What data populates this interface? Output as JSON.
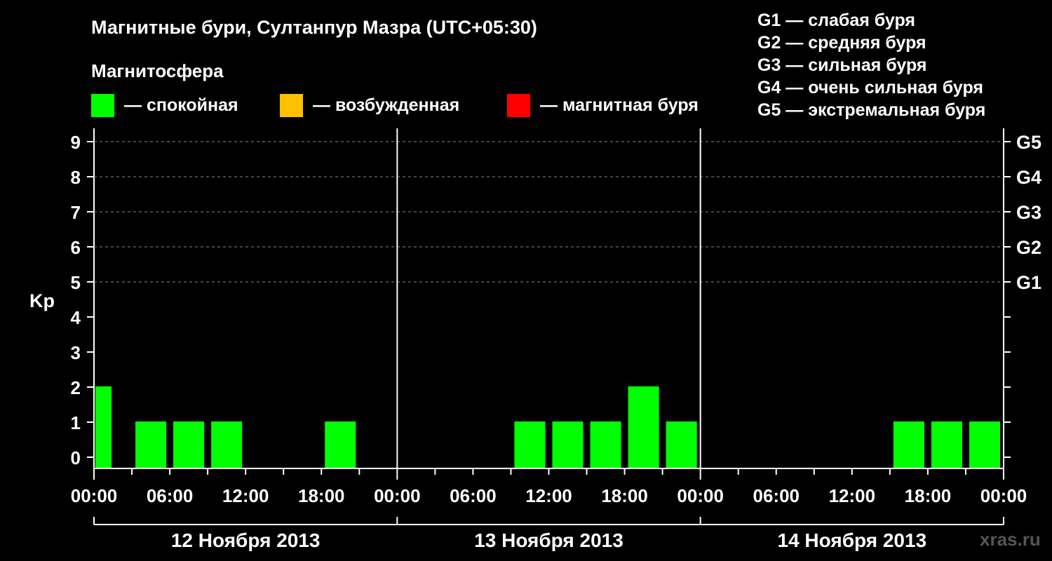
{
  "chart_data": {
    "type": "bar",
    "title": "Магнитные бури, Султанпур Мазра (UTC+05:30)",
    "subtitle": "Магнитосфера",
    "ylabel": "Kp",
    "ylim": [
      0,
      9
    ],
    "yticks": [
      0,
      1,
      2,
      3,
      4,
      5,
      6,
      7,
      8,
      9
    ],
    "grid_y_dashed": [
      5,
      6,
      7,
      8,
      9
    ],
    "right_axis_labels": [
      {
        "kp": 5,
        "label": "G1"
      },
      {
        "kp": 6,
        "label": "G2"
      },
      {
        "kp": 7,
        "label": "G3"
      },
      {
        "kp": 8,
        "label": "G4"
      },
      {
        "kp": 9,
        "label": "G5"
      }
    ],
    "legend_status": [
      {
        "color": "#00ff00",
        "label": "— спокойная"
      },
      {
        "color": "#ffc000",
        "label": "— возбужденная"
      },
      {
        "color": "#ff0000",
        "label": "— магнитная буря"
      }
    ],
    "legend_levels": [
      "G1 — слабая буря",
      "G2 — средняя буря",
      "G3 — сильная буря",
      "G4 — очень сильная буря",
      "G5 — экстремальная буря"
    ],
    "days": [
      {
        "label": "12 Ноября 2013",
        "kp": [
          2,
          1,
          1,
          1,
          0,
          0,
          1,
          0
        ],
        "first_slot_offset_hours": 1.5
      },
      {
        "label": "13 Ноября 2013",
        "kp": [
          0,
          0,
          0,
          1,
          1,
          1,
          2,
          1
        ],
        "first_slot_offset_hours": 0
      },
      {
        "label": "14 Ноября 2013",
        "kp": [
          0,
          0,
          0,
          0,
          0,
          1,
          1,
          1
        ],
        "first_slot_offset_hours": 0
      }
    ],
    "x_tick_labels": [
      "00:00",
      "06:00",
      "12:00",
      "18:00"
    ],
    "x_end_label": "00:00",
    "bar_color": "#00ff00",
    "credit": "xras.ru"
  }
}
